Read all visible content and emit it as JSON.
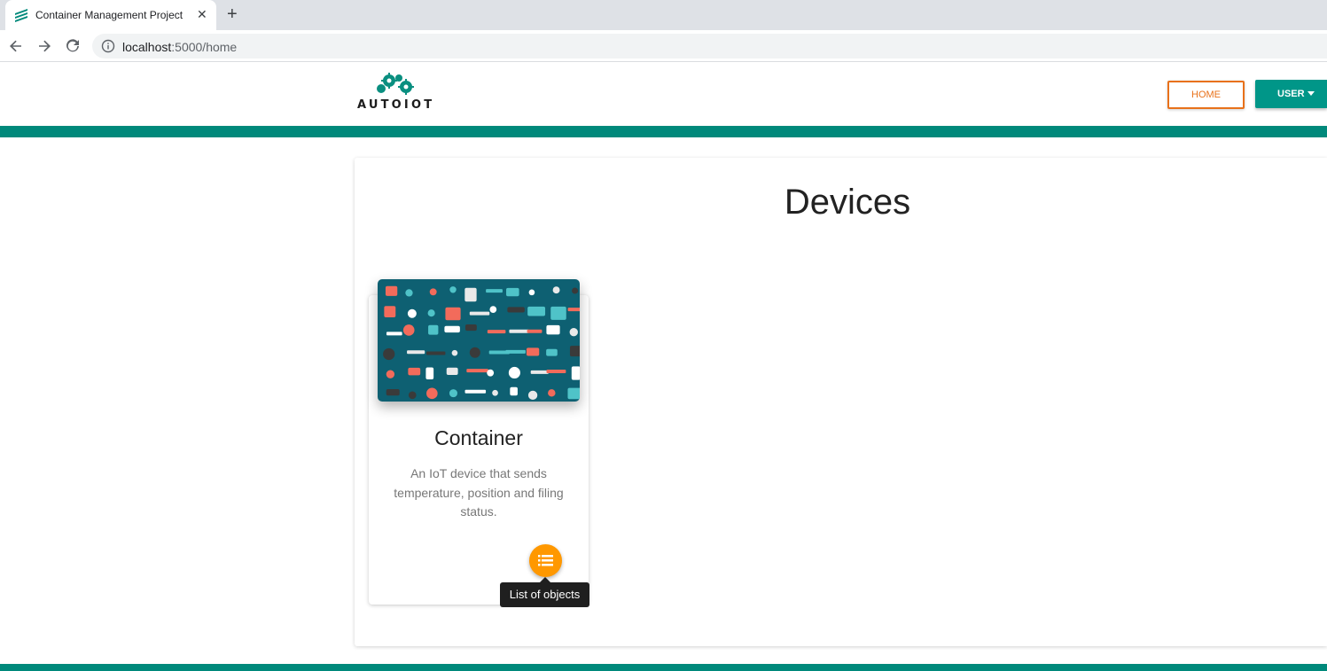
{
  "browser": {
    "tab_title": "Container Management Project",
    "tab_close": "✕",
    "new_tab": "+",
    "url_host": "localhost",
    "url_path": ":5000/home"
  },
  "header": {
    "logo_text": "AUTOIOT",
    "home_label": "HOME",
    "user_label": "USER"
  },
  "main": {
    "title": "Devices",
    "cards": [
      {
        "title": "Container",
        "description": "An IoT device that sends temperature, position and filing status.",
        "action_tooltip": "List of objects"
      }
    ]
  },
  "colors": {
    "teal": "#00897b",
    "orange": "#e8711a",
    "fab": "#ff9800"
  }
}
